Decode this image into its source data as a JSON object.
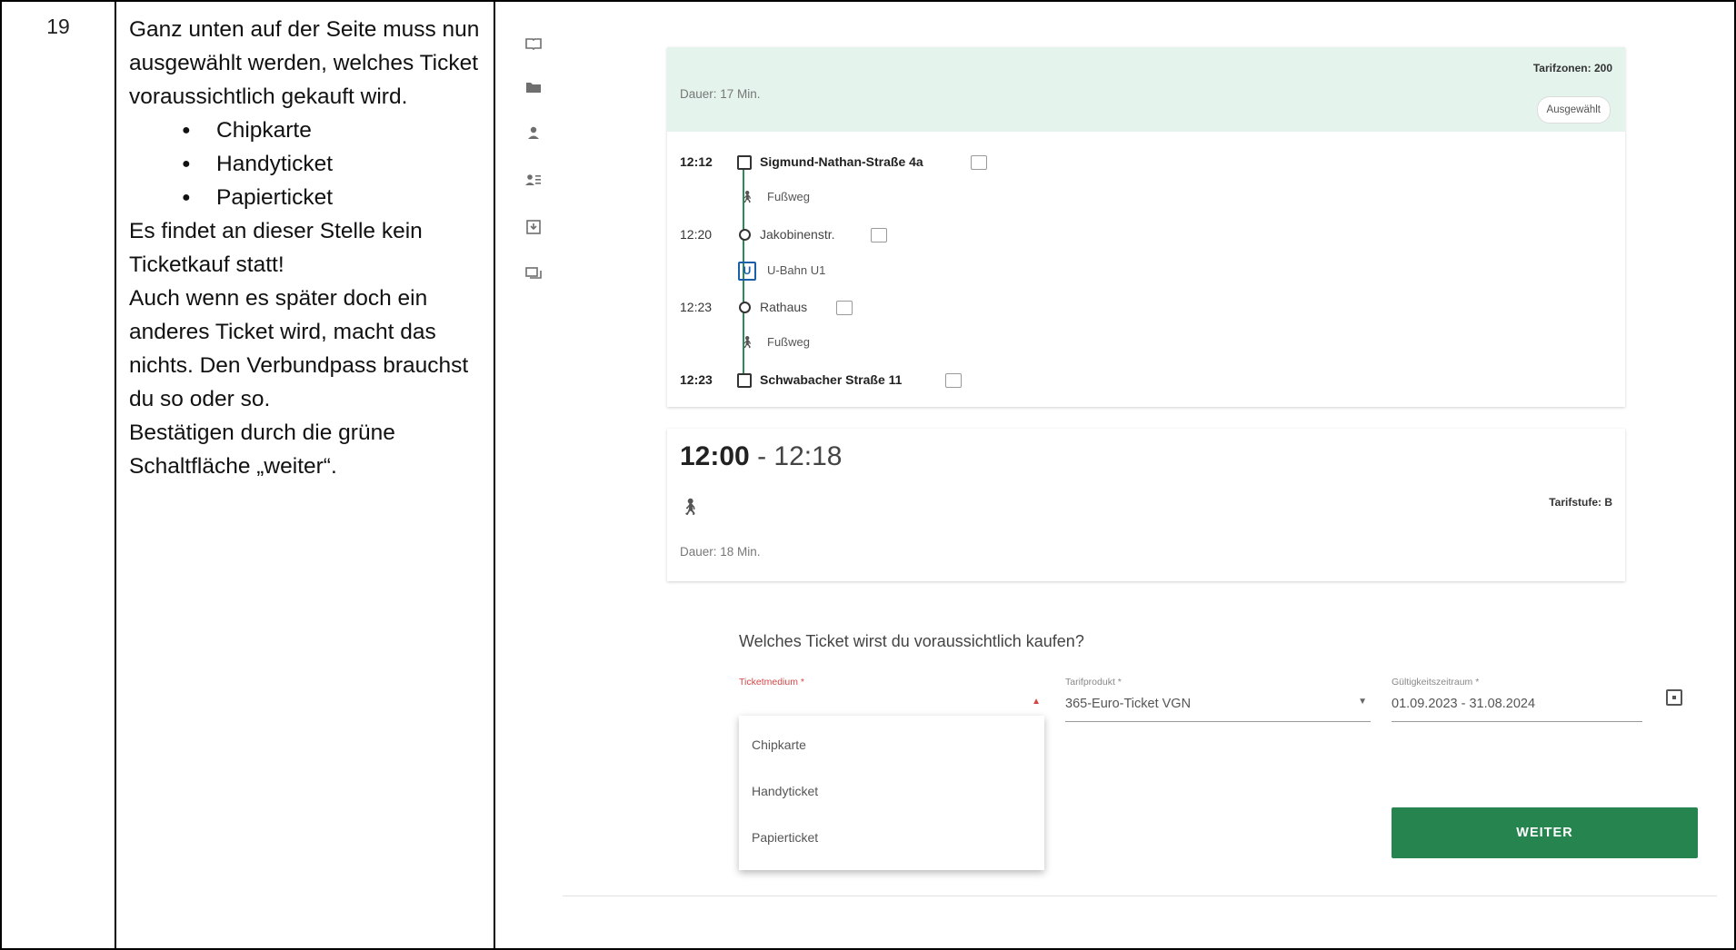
{
  "step": {
    "number": "19"
  },
  "instructions": {
    "p1": "Ganz unten auf der Seite muss nun ausgewählt werden, welches Ticket voraussichtlich gekauft wird.",
    "options": [
      "Chipkarte",
      "Handyticket",
      "Papierticket"
    ],
    "p2": "Es findet an dieser Stelle kein Ticketkauf statt!",
    "p3": "Auch wenn es später doch ein anderes Ticket wird, macht das nichts. Den Verbundpass brauchst du so oder so.",
    "p4": "Bestätigen durch die grüne Schaltfläche „weiter“."
  },
  "sidebar": {
    "icons": [
      "book-icon",
      "folder-icon",
      "person-icon",
      "person-list-icon",
      "download-icon",
      "chat-icon"
    ]
  },
  "connection1": {
    "tarifzonen": "Tarifzonen: 200",
    "dauer": "Dauer: 17 Min.",
    "selected_label": "Ausgewählt",
    "stops": [
      {
        "time": "12:12",
        "name": "Sigmund-Nathan-Straße 4a"
      },
      {
        "time": "12:20",
        "name": "Jakobinenstr."
      },
      {
        "time": "12:23",
        "name": "Rathaus"
      },
      {
        "time": "12:23",
        "name": "Schwabacher Straße 11"
      }
    ],
    "legs": [
      {
        "icon": "walk-icon",
        "label": "Fußweg"
      },
      {
        "icon": "ubahn-icon",
        "label": "U-Bahn U1",
        "badge": "U"
      },
      {
        "icon": "walk-icon",
        "label": "Fußweg"
      }
    ]
  },
  "connection2": {
    "time_start": "12:00",
    "time_end": " - 12:18",
    "tarifstufe": "Tarifstufe: B",
    "dauer": "Dauer: 18 Min."
  },
  "ticket_form": {
    "question": "Welches Ticket wirst du voraussichtlich kaufen?",
    "ticketmedium_label": "Ticketmedium *",
    "ticketmedium_value": "",
    "tarifprodukt_label": "Tarifprodukt *",
    "tarifprodukt_value": "365-Euro-Ticket VGN",
    "gueltigkeit_label": "Gültigkeitszeitraum *",
    "gueltigkeit_value": "01.09.2023 - 31.08.2024",
    "dropdown_options": [
      "Chipkarte",
      "Handyticket",
      "Papierticket"
    ],
    "weiter_label": "WEITER"
  },
  "colors": {
    "accent_green": "#26844e",
    "header_mint": "#e4f3ec",
    "error_red": "#d64545",
    "ubahn_blue": "#1b5fa8"
  }
}
